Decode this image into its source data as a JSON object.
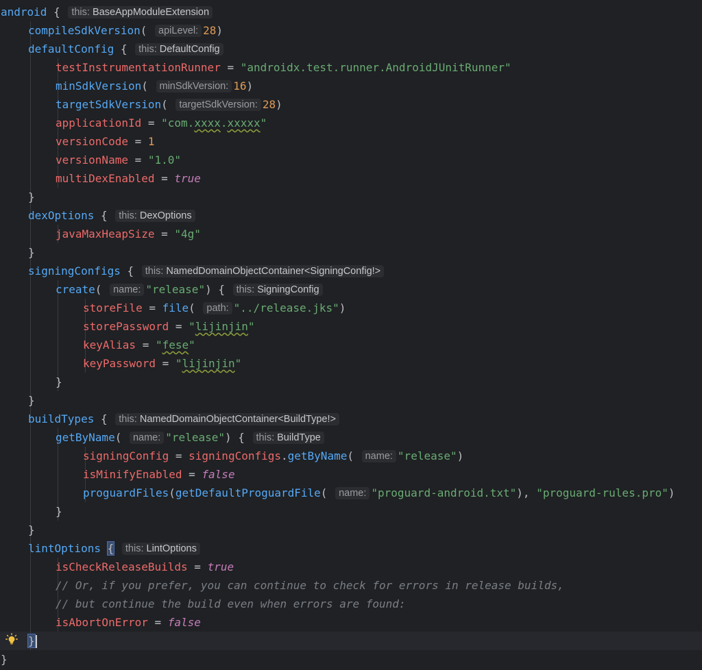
{
  "editor": {
    "lines": [
      {
        "indent": 0,
        "parts": [
          {
            "t": "android",
            "c": "meth"
          },
          {
            "t": " { ",
            "c": "k"
          },
          {
            "hint": "this:",
            "ht": "BaseAppModuleExtension"
          }
        ]
      },
      {
        "indent": 1,
        "parts": [
          {
            "t": "compileSdkVersion",
            "c": "meth"
          },
          {
            "t": "( ",
            "c": "k"
          },
          {
            "hint": "apiLevel:"
          },
          {
            "t": "28",
            "c": "num2"
          },
          {
            "t": ")",
            "c": "k"
          }
        ]
      },
      {
        "indent": 1,
        "parts": [
          {
            "t": "defaultConfig",
            "c": "meth"
          },
          {
            "t": " { ",
            "c": "k"
          },
          {
            "hint": "this:",
            "ht": "DefaultConfig"
          }
        ]
      },
      {
        "indent": 2,
        "parts": [
          {
            "t": "testInstrumentationRunner",
            "c": "prop"
          },
          {
            "t": " = ",
            "c": "k"
          },
          {
            "t": "\"androidx.test.runner.AndroidJUnitRunner\"",
            "c": "str"
          }
        ]
      },
      {
        "indent": 2,
        "parts": [
          {
            "t": "minSdkVersion",
            "c": "meth"
          },
          {
            "t": "( ",
            "c": "k"
          },
          {
            "hint": "minSdkVersion:"
          },
          {
            "t": "16",
            "c": "num2"
          },
          {
            "t": ")",
            "c": "k"
          }
        ]
      },
      {
        "indent": 2,
        "parts": [
          {
            "t": "targetSdkVersion",
            "c": "meth"
          },
          {
            "t": "( ",
            "c": "k"
          },
          {
            "hint": "targetSdkVersion:"
          },
          {
            "t": "28",
            "c": "num2"
          },
          {
            "t": ")",
            "c": "k"
          }
        ]
      },
      {
        "indent": 2,
        "parts": [
          {
            "t": "applicationId",
            "c": "prop"
          },
          {
            "t": " = ",
            "c": "k"
          },
          {
            "t": "\"com.",
            "c": "str"
          },
          {
            "t": "xxxx",
            "c": "str squig"
          },
          {
            "t": ".",
            "c": "str"
          },
          {
            "t": "xxxxx",
            "c": "str squig"
          },
          {
            "t": "\"",
            "c": "str"
          }
        ]
      },
      {
        "indent": 2,
        "parts": [
          {
            "t": "versionCode",
            "c": "prop"
          },
          {
            "t": " = ",
            "c": "k"
          },
          {
            "t": "1",
            "c": "num2"
          }
        ]
      },
      {
        "indent": 2,
        "parts": [
          {
            "t": "versionName",
            "c": "prop"
          },
          {
            "t": " = ",
            "c": "k"
          },
          {
            "t": "\"1.0\"",
            "c": "str"
          }
        ]
      },
      {
        "indent": 2,
        "parts": [
          {
            "t": "multiDexEnabled",
            "c": "prop"
          },
          {
            "t": " = ",
            "c": "k"
          },
          {
            "t": "true",
            "c": "bool"
          }
        ]
      },
      {
        "indent": 1,
        "parts": [
          {
            "t": "}",
            "c": "k"
          }
        ]
      },
      {
        "indent": 1,
        "parts": [
          {
            "t": "dexOptions",
            "c": "meth"
          },
          {
            "t": " { ",
            "c": "k"
          },
          {
            "hint": "this:",
            "ht": "DexOptions"
          }
        ]
      },
      {
        "indent": 2,
        "parts": [
          {
            "t": "javaMaxHeapSize",
            "c": "prop"
          },
          {
            "t": " = ",
            "c": "k"
          },
          {
            "t": "\"4g\"",
            "c": "str"
          }
        ]
      },
      {
        "indent": 1,
        "parts": [
          {
            "t": "}",
            "c": "k"
          }
        ]
      },
      {
        "indent": 1,
        "parts": [
          {
            "t": "signingConfigs",
            "c": "meth"
          },
          {
            "t": " { ",
            "c": "k"
          },
          {
            "hint": "this:",
            "ht": "NamedDomainObjectContainer<SigningConfig!>"
          }
        ]
      },
      {
        "indent": 2,
        "parts": [
          {
            "t": "create",
            "c": "meth"
          },
          {
            "t": "( ",
            "c": "k"
          },
          {
            "hint": "name:"
          },
          {
            "t": "\"release\"",
            "c": "str"
          },
          {
            "t": ") { ",
            "c": "k"
          },
          {
            "hint": "this:",
            "ht": "SigningConfig"
          }
        ]
      },
      {
        "indent": 3,
        "parts": [
          {
            "t": "storeFile",
            "c": "prop"
          },
          {
            "t": " = ",
            "c": "k"
          },
          {
            "t": "file",
            "c": "meth"
          },
          {
            "t": "( ",
            "c": "k"
          },
          {
            "hint": "path:"
          },
          {
            "t": "\"../release.jks\"",
            "c": "str"
          },
          {
            "t": ")",
            "c": "k"
          }
        ]
      },
      {
        "indent": 3,
        "parts": [
          {
            "t": "storePassword",
            "c": "prop"
          },
          {
            "t": " = ",
            "c": "k"
          },
          {
            "t": "\"",
            "c": "str"
          },
          {
            "t": "lijinjin",
            "c": "str squig"
          },
          {
            "t": "\"",
            "c": "str"
          }
        ]
      },
      {
        "indent": 3,
        "parts": [
          {
            "t": "keyAlias",
            "c": "prop"
          },
          {
            "t": " = ",
            "c": "k"
          },
          {
            "t": "\"",
            "c": "str"
          },
          {
            "t": "fese",
            "c": "str squig"
          },
          {
            "t": "\"",
            "c": "str"
          }
        ]
      },
      {
        "indent": 3,
        "parts": [
          {
            "t": "keyPassword",
            "c": "prop"
          },
          {
            "t": " = ",
            "c": "k"
          },
          {
            "t": "\"",
            "c": "str"
          },
          {
            "t": "lijinjin",
            "c": "str squig"
          },
          {
            "t": "\"",
            "c": "str"
          }
        ]
      },
      {
        "indent": 2,
        "parts": [
          {
            "t": "}",
            "c": "k"
          }
        ]
      },
      {
        "indent": 1,
        "parts": [
          {
            "t": "}",
            "c": "k"
          }
        ]
      },
      {
        "indent": 1,
        "parts": [
          {
            "t": "buildTypes",
            "c": "meth"
          },
          {
            "t": " { ",
            "c": "k"
          },
          {
            "hint": "this:",
            "ht": "NamedDomainObjectContainer<BuildType!>"
          }
        ]
      },
      {
        "indent": 2,
        "parts": [
          {
            "t": "getByName",
            "c": "meth"
          },
          {
            "t": "( ",
            "c": "k"
          },
          {
            "hint": "name:"
          },
          {
            "t": "\"release\"",
            "c": "str"
          },
          {
            "t": ") { ",
            "c": "k"
          },
          {
            "hint": "this:",
            "ht": "BuildType"
          }
        ]
      },
      {
        "indent": 3,
        "parts": [
          {
            "t": "signingConfig",
            "c": "prop"
          },
          {
            "t": " = ",
            "c": "k"
          },
          {
            "t": "signingConfigs",
            "c": "prop"
          },
          {
            "t": ".",
            "c": "k"
          },
          {
            "t": "getByName",
            "c": "meth"
          },
          {
            "t": "( ",
            "c": "k"
          },
          {
            "hint": "name:"
          },
          {
            "t": "\"release\"",
            "c": "str"
          },
          {
            "t": ")",
            "c": "k"
          }
        ]
      },
      {
        "indent": 3,
        "parts": [
          {
            "t": "isMinifyEnabled",
            "c": "prop"
          },
          {
            "t": " = ",
            "c": "k"
          },
          {
            "t": "false",
            "c": "bool"
          }
        ]
      },
      {
        "indent": 3,
        "parts": [
          {
            "t": "proguardFiles",
            "c": "meth"
          },
          {
            "t": "(",
            "c": "k"
          },
          {
            "t": "getDefaultProguardFile",
            "c": "meth"
          },
          {
            "t": "( ",
            "c": "k"
          },
          {
            "hint": "name:"
          },
          {
            "t": "\"proguard-android.txt\"",
            "c": "str"
          },
          {
            "t": "), ",
            "c": "k"
          },
          {
            "t": "\"proguard-rules.pro\"",
            "c": "str"
          },
          {
            "t": ")",
            "c": "k"
          }
        ]
      },
      {
        "indent": 2,
        "parts": [
          {
            "t": "}",
            "c": "k"
          }
        ]
      },
      {
        "indent": 1,
        "parts": [
          {
            "t": "}",
            "c": "k"
          }
        ]
      },
      {
        "indent": 1,
        "parts": [
          {
            "t": "lintOptions",
            "c": "meth"
          },
          {
            "t": " ",
            "c": "k"
          },
          {
            "t": "{",
            "c": "k bracket-hl"
          },
          {
            "t": " ",
            "c": "k"
          },
          {
            "hint": "this:",
            "ht": "LintOptions"
          }
        ]
      },
      {
        "indent": 2,
        "parts": [
          {
            "t": "isCheckReleaseBuilds",
            "c": "prop"
          },
          {
            "t": " = ",
            "c": "k"
          },
          {
            "t": "true",
            "c": "bool"
          }
        ]
      },
      {
        "indent": 2,
        "parts": [
          {
            "t": "// Or, if you prefer, you can continue to check for errors in release builds,",
            "c": "cmt"
          }
        ]
      },
      {
        "indent": 2,
        "parts": [
          {
            "t": "// but continue the build even when errors are found:",
            "c": "cmt"
          }
        ]
      },
      {
        "indent": 2,
        "parts": [
          {
            "t": "isAbortOnError",
            "c": "prop"
          },
          {
            "t": " = ",
            "c": "k"
          },
          {
            "t": "false",
            "c": "bool"
          }
        ]
      },
      {
        "indent": 1,
        "current": true,
        "caret": true,
        "parts": [
          {
            "t": "}",
            "c": "k bracket-hl"
          }
        ]
      },
      {
        "indent": 0,
        "parts": [
          {
            "t": "}",
            "c": "k"
          }
        ]
      }
    ]
  },
  "gutter": {
    "bulb_icon": "lightbulb-icon"
  }
}
